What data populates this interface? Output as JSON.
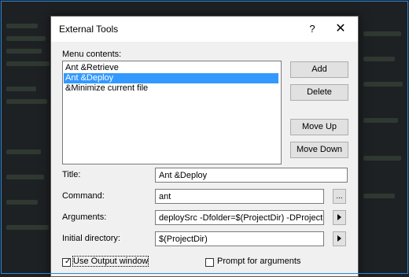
{
  "dialog": {
    "title": "External Tools",
    "help_label": "?",
    "close_label": "✕"
  },
  "menu_contents": {
    "label": "Menu contents:",
    "items": [
      {
        "label": "Ant &Retrieve",
        "selected": false
      },
      {
        "label": "Ant &Deploy",
        "selected": true
      },
      {
        "label": "&Minimize current file",
        "selected": false
      }
    ]
  },
  "buttons": {
    "add": "Add",
    "delete": "Delete",
    "move_up": "Move Up",
    "move_down": "Move Down"
  },
  "fields": {
    "title_label": "Title:",
    "title_value": "Ant &Deploy",
    "command_label": "Command:",
    "command_value": "ant",
    "browse_label": "...",
    "arguments_label": "Arguments:",
    "arguments_value": "deploySrc -Dfolder=$(ProjectDir) -DProject=$(Pr",
    "initial_dir_label": "Initial directory:",
    "initial_dir_value": "$(ProjectDir)"
  },
  "options": {
    "use_output_window": "Use Output window",
    "use_output_checked": true,
    "prompt_for_arguments": "Prompt for arguments",
    "prompt_checked": false
  }
}
